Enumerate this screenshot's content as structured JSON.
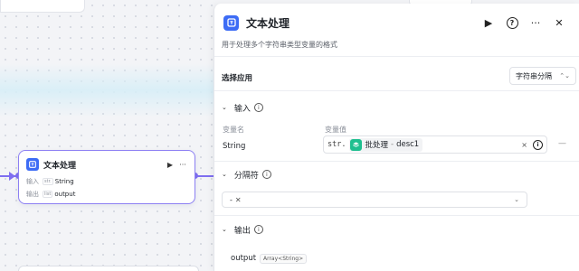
{
  "canvas": {
    "node": {
      "title": "文本处理",
      "play_icon": "▶",
      "more_icon": "···",
      "inputs_label": "输入",
      "input_type_tag": "str.",
      "input_value": "String",
      "outputs_label": "输出",
      "output_type_tag": "list",
      "output_value": "output"
    }
  },
  "panel": {
    "title": "文本处理",
    "description": "用于处理多个字符串类型变量的格式",
    "header_icons": [
      "play-icon",
      "help-icon",
      "more-icon",
      "close-icon"
    ],
    "help_glyph": "?",
    "play_glyph": "▶",
    "more_glyph": "···",
    "close_glyph": "✕",
    "select_app": {
      "label": "选择应用",
      "value": "字符串分隔",
      "chevron": "⌃⌄"
    },
    "input_section": {
      "title": "输入",
      "info": "i",
      "col_name": "变量名",
      "col_value": "变量值",
      "row": {
        "name": "String",
        "type_prefix": "str.",
        "ref_source": "批处理",
        "ref_separator": "-",
        "ref_var": "desc1",
        "clear": "×",
        "remove": "—"
      }
    },
    "separator_section": {
      "title": "分隔符",
      "info": "i",
      "tag": "-",
      "tag_remove": "✕",
      "chevron": "⌄"
    },
    "output_section": {
      "title": "输出",
      "info": "i",
      "name": "output",
      "type": "Array<String>"
    },
    "caret": "⌄",
    "colors": {
      "accent": "#3d6cf5",
      "edge": "#7f6ff0",
      "batch_badge": "#1fbf8f"
    }
  }
}
